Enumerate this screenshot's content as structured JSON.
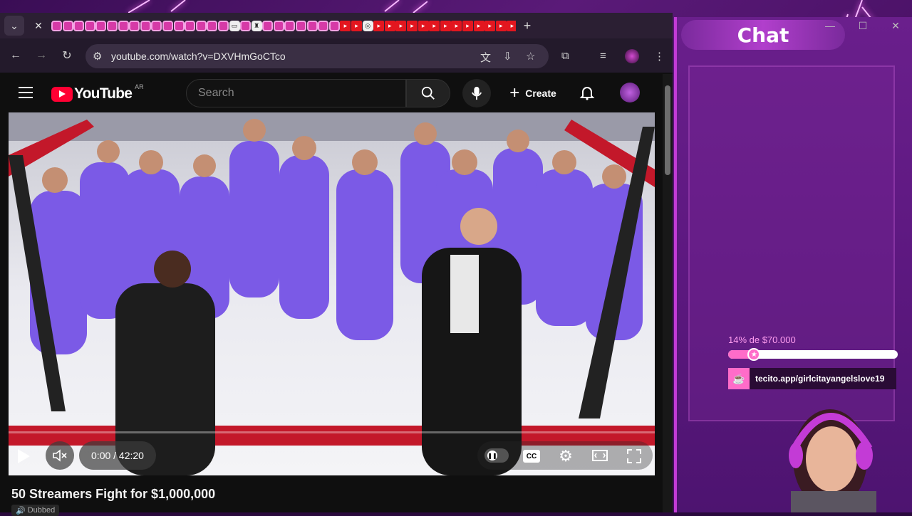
{
  "browser": {
    "url": "youtube.com/watch?v=DXVHmGoCTco",
    "new_tab": "+",
    "tab_count_pink_before": 16,
    "tab_count_pink_after": 7,
    "tab_count_red": 15
  },
  "youtube": {
    "logo_text": "YouTube",
    "country_code": "AR",
    "search_placeholder": "Search",
    "create_label": "Create",
    "video": {
      "title": "50 Streamers Fight for $1,000,000",
      "badge": "Dubbed",
      "time_current": "0:00",
      "time_total": "42:20",
      "time_display": "0:00 / 42:20",
      "progress": 0,
      "cc_label": "CC"
    }
  },
  "overlay": {
    "chat_title": "Chat",
    "goal_label": "14% de $70.000",
    "goal_fraction": 0.14,
    "tecito_link": "tecito.app/girlcitayangelslove19",
    "accent": "#ff6cc9"
  }
}
